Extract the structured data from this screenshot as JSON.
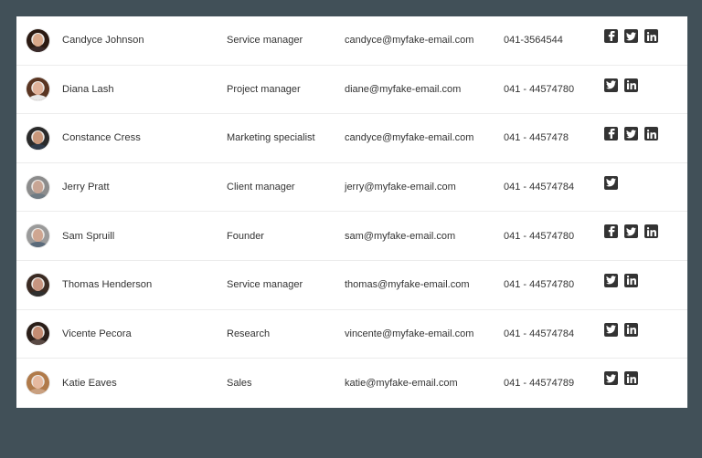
{
  "contacts": [
    {
      "name": "Candyce Johnson",
      "role": "Service manager",
      "email": "candyce@myfake-email.com",
      "phone": "041-3564544",
      "social": [
        "facebook",
        "twitter",
        "linkedin"
      ],
      "avatar": {
        "skin": "#d9a88a",
        "hair": "#2b1a12",
        "shirt": "#3a2a2a"
      }
    },
    {
      "name": "Diana Lash",
      "role": "Project manager",
      "email": "diane@myfake-email.com",
      "phone": "041 - 44574780",
      "social": [
        "twitter",
        "linkedin"
      ],
      "avatar": {
        "skin": "#e0b29a",
        "hair": "#5a3522",
        "shirt": "#e8e8e8"
      }
    },
    {
      "name": "Constance Cress",
      "role": "Marketing specialist",
      "email": "candyce@myfake-email.com",
      "phone": "041 - 4457478",
      "social": [
        "facebook",
        "twitter",
        "linkedin"
      ],
      "avatar": {
        "skin": "#c9977a",
        "hair": "#2a2a2a",
        "shirt": "#2e3a4a"
      }
    },
    {
      "name": "Jerry Pratt",
      "role": "Client manager",
      "email": "jerry@myfake-email.com",
      "phone": "041 - 44574784",
      "social": [
        "twitter"
      ],
      "avatar": {
        "skin": "#c8a594",
        "hair": "#8c8c8c",
        "shirt": "#6f7b84"
      }
    },
    {
      "name": "Sam Spruill",
      "role": "Founder",
      "email": "sam@myfake-email.com",
      "phone": "041 - 44574780",
      "social": [
        "facebook",
        "twitter",
        "linkedin"
      ],
      "avatar": {
        "skin": "#cfa691",
        "hair": "#9a9a9a",
        "shirt": "#5a6a7a"
      }
    },
    {
      "name": "Thomas Henderson",
      "role": "Service manager",
      "email": "thomas@myfake-email.com",
      "phone": "041 - 44574780",
      "social": [
        "twitter",
        "linkedin"
      ],
      "avatar": {
        "skin": "#c79580",
        "hair": "#3a2a22",
        "shirt": "#2f2f2f"
      }
    },
    {
      "name": "Vicente Pecora",
      "role": "Research",
      "email": "vincente@myfake-email.com",
      "phone": "041 - 44574784",
      "social": [
        "twitter",
        "linkedin"
      ],
      "avatar": {
        "skin": "#c48c72",
        "hair": "#2a1e18",
        "shirt": "#5a4a44"
      }
    },
    {
      "name": "Katie Eaves",
      "role": "Sales",
      "email": "katie@myfake-email.com",
      "phone": "041 - 44574789",
      "social": [
        "twitter",
        "linkedin"
      ],
      "avatar": {
        "skin": "#e6b99f",
        "hair": "#b07a4a",
        "shirt": "#c9a080"
      }
    }
  ],
  "colors": {
    "background": "#415058",
    "card": "#ffffff",
    "icon": "#333333"
  }
}
